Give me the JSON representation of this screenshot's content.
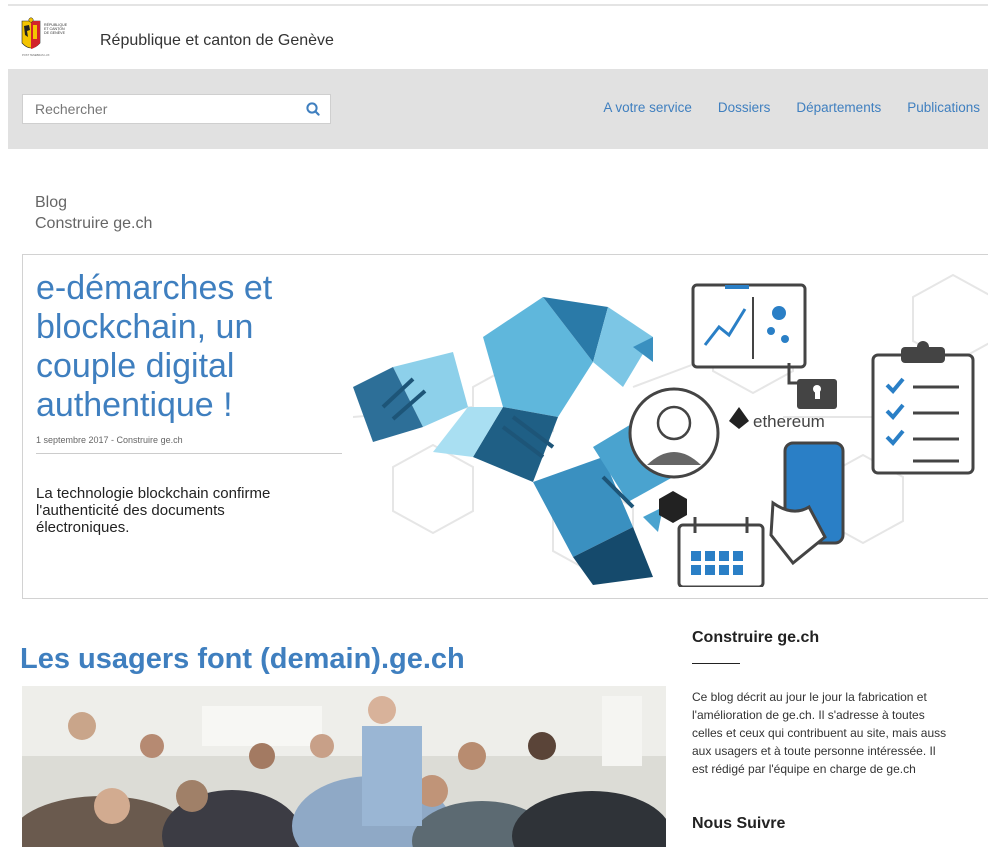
{
  "header": {
    "logo_text": "RÉPUBLIQUE ET CANTON DE GENÈVE",
    "site_name": "République et canton de Genève"
  },
  "search": {
    "placeholder": "Rechercher"
  },
  "nav": {
    "items": [
      {
        "label": "A votre service"
      },
      {
        "label": "Dossiers"
      },
      {
        "label": "Départements"
      },
      {
        "label": "Publications"
      }
    ]
  },
  "blog": {
    "label": "Blog",
    "title": "Construire ge.ch"
  },
  "featured": {
    "title": "e-démarches et blockchain, un couple digital authentique !",
    "meta": "1 septembre 2017 - Construire ge.ch",
    "summary": "La technologie blockchain confirme l'authenticité des documents électroniques.",
    "image_label": "ethereum"
  },
  "article": {
    "title": "Les usagers font (demain).ge.ch"
  },
  "sidebar": {
    "about_heading": "Construire ge.ch",
    "about_lines": [
      "Ce blog décrit au jour le jour la fabrication et",
      "l'amélioration de ge.ch. Il s'adresse à toutes",
      "celles et ceux qui contribuent au site, mais auss",
      "aux  usagers et à toute personne intéressée. Il",
      "est rédigé par l'équipe en charge de ge.ch"
    ],
    "follow_heading": "Nous Suivre"
  },
  "colors": {
    "link": "#3f7fbf",
    "nav_band": "#e1e1e1",
    "crest_red": "#d2232a",
    "crest_yellow": "#f4c400"
  },
  "icons": {
    "search": "search-icon",
    "logo": "geneva-crest-icon"
  }
}
